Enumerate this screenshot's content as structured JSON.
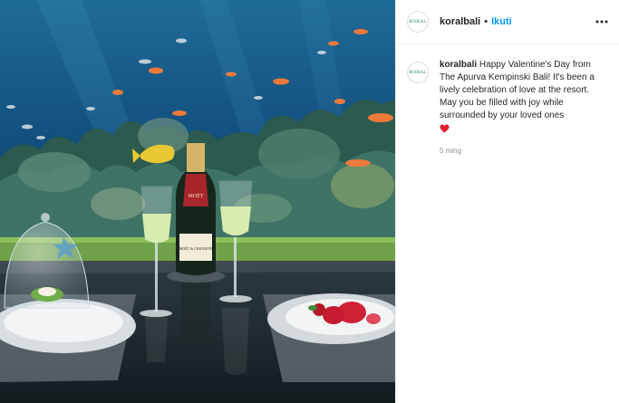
{
  "post": {
    "username": "koralbali",
    "follow_label": "Ikuti",
    "separator": "•",
    "avatar_text": "KORAL",
    "more_icon": "more-options-icon",
    "caption": {
      "author": "koralbali",
      "text": "Happy Valentine's Day from The Apurva Kempinski Bali! It's been a lively celebration of love at the resort. May you be filled with joy while surrounded by your loved ones",
      "emoji_icon": "red-heart-icon"
    },
    "timestamp": "5 ming"
  },
  "photo": {
    "bottle_label": "MOËT",
    "bottle_brand": "MOËT & CHANDON"
  },
  "colors": {
    "link_blue": "#0095f6",
    "text_dark": "#262626",
    "muted": "#8e8e8e",
    "heart_red": "#e0202f"
  }
}
